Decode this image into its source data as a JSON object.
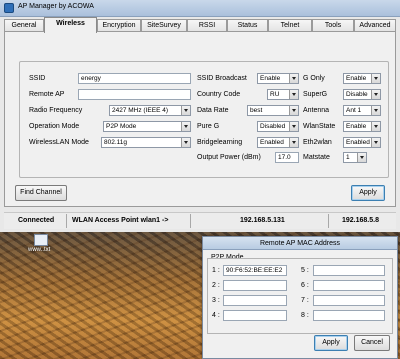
{
  "window": {
    "title": "AP Manager by ACOWA"
  },
  "tabs": [
    {
      "label": "General"
    },
    {
      "label": "Wireless"
    },
    {
      "label": "Encryption"
    },
    {
      "label": "SiteSurvey"
    },
    {
      "label": "RSSI"
    },
    {
      "label": "Status"
    },
    {
      "label": "Telnet"
    },
    {
      "label": "Tools"
    },
    {
      "label": "Advanced"
    }
  ],
  "form": {
    "ssid_label": "SSID",
    "ssid_value": "energy",
    "remote_ap_label": "Remote AP",
    "remote_ap_value": "",
    "radio_freq_label": "Radio Frequency",
    "radio_freq_value": "2427 MHz (IEEE 4)",
    "op_mode_label": "Operation Mode",
    "op_mode_value": "P2P Mode",
    "wlan_mode_label": "WirelessLAN  Mode",
    "wlan_mode_value": "802.11g",
    "ssid_broadcast_label": "SSID Broadcast",
    "ssid_broadcast_value": "Enable",
    "country_code_label": "Country Code",
    "country_code_value": "RU",
    "data_rate_label": "Data Rate",
    "data_rate_value": "best",
    "pure_g_label": "Pure G",
    "pure_g_value": "Disabled",
    "bridgelearning_label": "Bridgelearning",
    "bridgelearning_value": "Enabled",
    "output_power_label": "Output Power (dBm)",
    "output_power_value": "17.0",
    "g_only_label": "G Only",
    "g_only_value": "Enable",
    "superg_label": "SuperG",
    "superg_value": "Disable",
    "antenna_label": "Antenna",
    "antenna_value": "Ant 1",
    "wlanstate_label": "WlanState",
    "wlanstate_value": "Enable",
    "eth2wlan_label": "Eth2wlan",
    "eth2wlan_value": "Enabled",
    "matstate_label": "Matstate",
    "matstate_value": "1"
  },
  "buttons": {
    "find_channel": "Find Channel",
    "apply": "Apply"
  },
  "status_bar": {
    "connected": "Connected",
    "mode": "WLAN Access Point wlan1 ->",
    "ip_local": "192.168.5.131",
    "ip_remote": "192.168.5.8"
  },
  "desktop": {
    "icon_label": "www..txt"
  },
  "popup": {
    "title": "Remote AP MAC Address",
    "group_label": "P2P Mode",
    "entries": [
      {
        "label": "1 :",
        "value": "90:F6:52:BE:EE:E2"
      },
      {
        "label": "2 :",
        "value": ""
      },
      {
        "label": "3 :",
        "value": ""
      },
      {
        "label": "4 :",
        "value": ""
      },
      {
        "label": "5 :",
        "value": ""
      },
      {
        "label": "6 :",
        "value": ""
      },
      {
        "label": "7 :",
        "value": ""
      },
      {
        "label": "8 :",
        "value": ""
      }
    ],
    "apply_label": "Apply",
    "cancel_label": "Cancel"
  }
}
